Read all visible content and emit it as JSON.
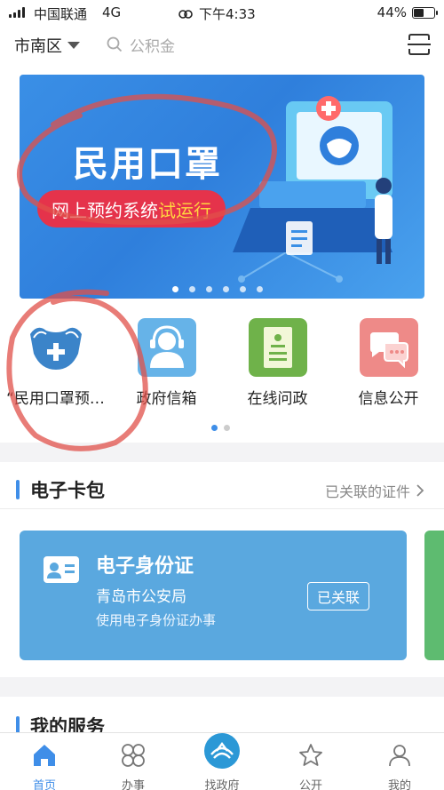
{
  "status_bar": {
    "carrier": "中国联通",
    "network": "4G",
    "time": "下午4:33",
    "battery": "44%",
    "battery_level": 0.44
  },
  "header": {
    "city": "市南区",
    "search_placeholder": "公积金",
    "icons": [
      "chevron-down-icon",
      "search-icon",
      "scan-icon"
    ]
  },
  "banner": {
    "title": "民用口罩",
    "subtitle_prefix": "网上预约系统",
    "subtitle_highlight": "试运行",
    "slide_count": 6,
    "active_slide": 0
  },
  "quick_services": [
    {
      "label": "“民用口罩预…",
      "icon": "mask-plus-icon",
      "color": "#3b84c9"
    },
    {
      "label": "政府信箱",
      "icon": "headset-person-icon",
      "color": "#66b3e8"
    },
    {
      "label": "在线问政",
      "icon": "document-icon",
      "color": "#6fb24a"
    },
    {
      "label": "信息公开",
      "icon": "chat-bubbles-icon",
      "color": "#ee8a88"
    }
  ],
  "quick_page_count": 2,
  "wallet": {
    "title": "电子卡包",
    "link": "已关联的证件",
    "card": {
      "title": "电子身份证",
      "org": "青岛市公安局",
      "desc": "使用电子身份证办事",
      "badge": "已关联",
      "color": "#5aa8df"
    }
  },
  "services": {
    "title": "我的服务"
  },
  "tabs": [
    {
      "label": "首页",
      "icon": "home-icon",
      "active": true
    },
    {
      "label": "办事",
      "icon": "grid-icon",
      "active": false
    },
    {
      "label": "找政府",
      "icon": "government-logo-icon",
      "active": false
    },
    {
      "label": "公开",
      "icon": "star-icon",
      "active": false
    },
    {
      "label": "我的",
      "icon": "user-icon",
      "active": false
    }
  ],
  "accent_color": "#3f8ee8"
}
